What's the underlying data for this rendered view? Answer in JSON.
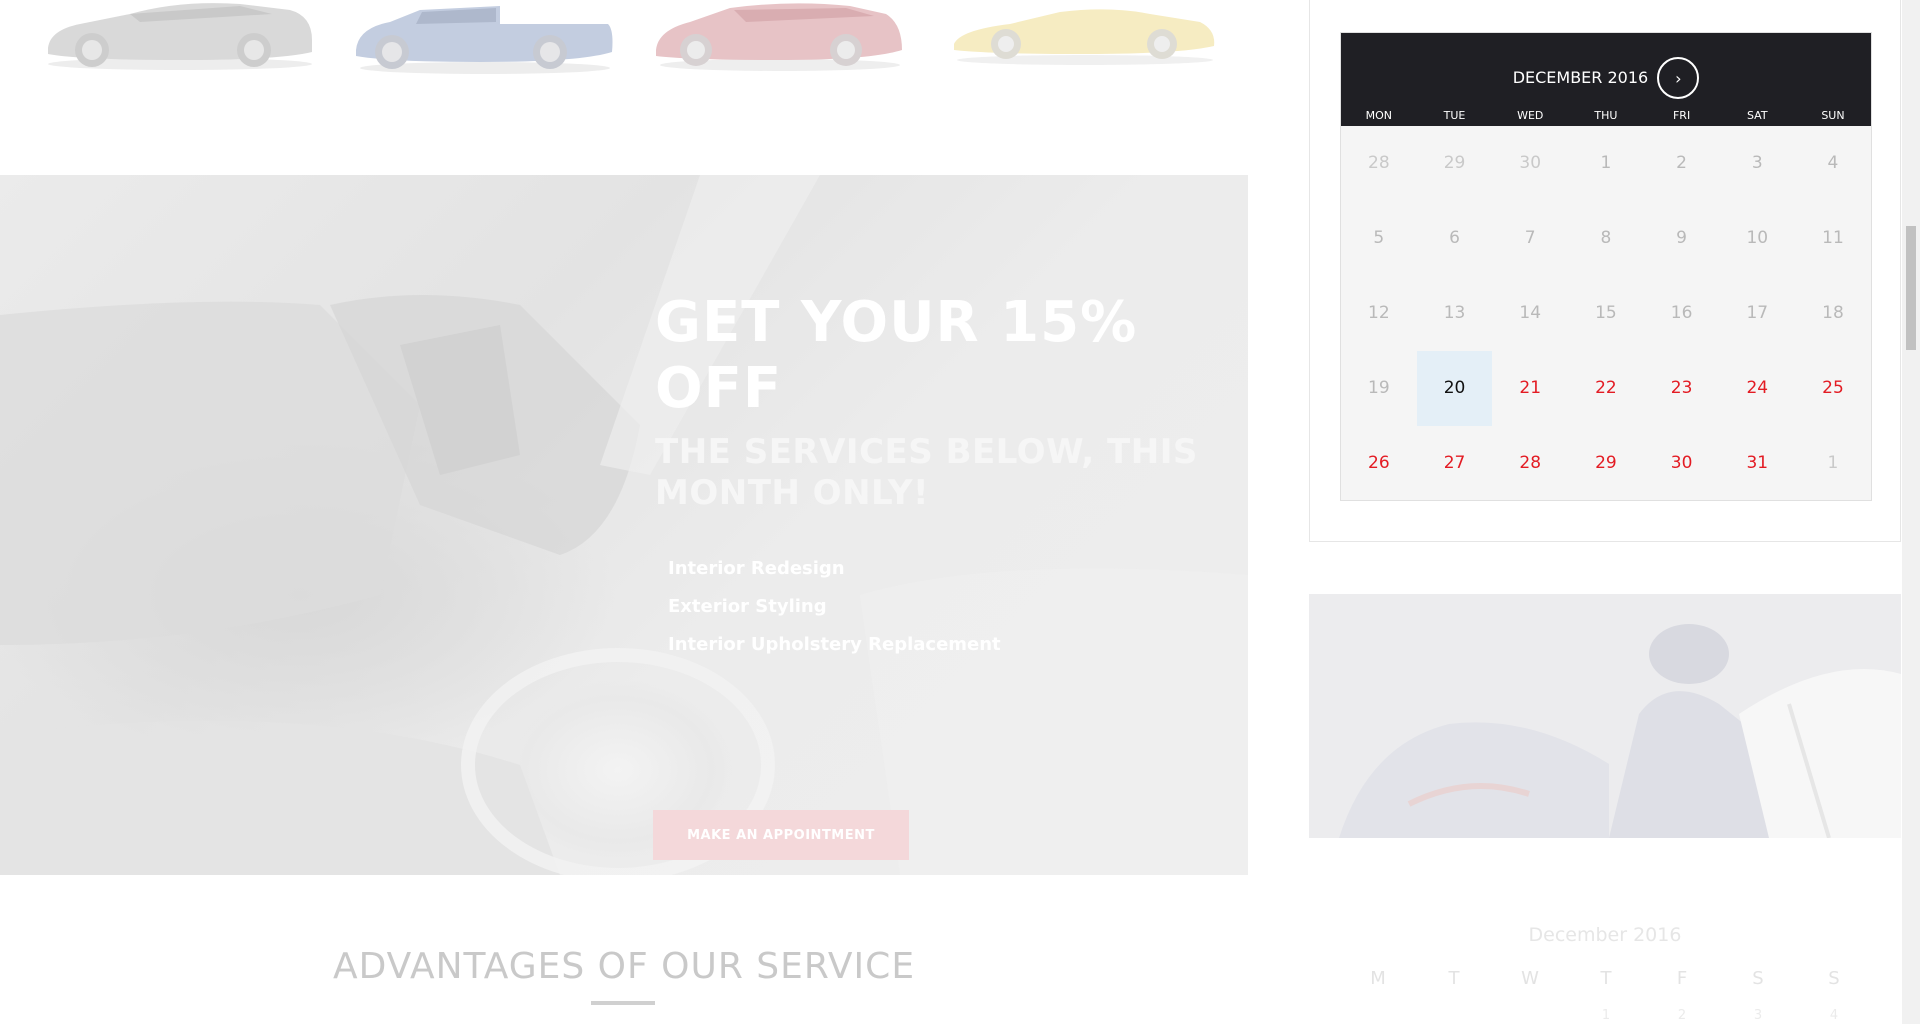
{
  "promo": {
    "title_line1": "GET YOUR 15%",
    "title_line2": "OFF",
    "subtitle_line1": "THE SERVICES BELOW, THIS",
    "subtitle_line2": "MONTH ONLY!",
    "services": [
      "Interior Redesign",
      "Exterior Styling",
      "Interior Upholstery Replacement"
    ],
    "button_label": "MAKE AN APPOINTMENT"
  },
  "advantages": {
    "title": "ADVANTAGES OF OUR SERVICE"
  },
  "calendar": {
    "month_label": "DECEMBER 2016",
    "next_icon": "chevron-right-icon",
    "next_glyph": "›",
    "weekdays": [
      "MON",
      "TUE",
      "WED",
      "THU",
      "FRI",
      "SAT",
      "SUN"
    ],
    "weeks": [
      [
        {
          "d": "28",
          "s": "muted"
        },
        {
          "d": "29",
          "s": "muted"
        },
        {
          "d": "30",
          "s": "muted"
        },
        {
          "d": "1",
          "s": "past"
        },
        {
          "d": "2",
          "s": "past"
        },
        {
          "d": "3",
          "s": "past"
        },
        {
          "d": "4",
          "s": "past"
        }
      ],
      [
        {
          "d": "5",
          "s": "past"
        },
        {
          "d": "6",
          "s": "past"
        },
        {
          "d": "7",
          "s": "past"
        },
        {
          "d": "8",
          "s": "past"
        },
        {
          "d": "9",
          "s": "past"
        },
        {
          "d": "10",
          "s": "past"
        },
        {
          "d": "11",
          "s": "past"
        }
      ],
      [
        {
          "d": "12",
          "s": "past"
        },
        {
          "d": "13",
          "s": "past"
        },
        {
          "d": "14",
          "s": "past"
        },
        {
          "d": "15",
          "s": "past"
        },
        {
          "d": "16",
          "s": "past"
        },
        {
          "d": "17",
          "s": "past"
        },
        {
          "d": "18",
          "s": "past"
        }
      ],
      [
        {
          "d": "19",
          "s": "past"
        },
        {
          "d": "20",
          "s": "today"
        },
        {
          "d": "21",
          "s": "avail"
        },
        {
          "d": "22",
          "s": "avail"
        },
        {
          "d": "23",
          "s": "avail"
        },
        {
          "d": "24",
          "s": "avail"
        },
        {
          "d": "25",
          "s": "avail"
        }
      ],
      [
        {
          "d": "26",
          "s": "avail"
        },
        {
          "d": "27",
          "s": "avail"
        },
        {
          "d": "28",
          "s": "avail"
        },
        {
          "d": "29",
          "s": "avail"
        },
        {
          "d": "30",
          "s": "avail"
        },
        {
          "d": "31",
          "s": "avail"
        },
        {
          "d": "1",
          "s": "muted"
        }
      ]
    ],
    "colors": {
      "header": "#1f1f24",
      "available": "#e31b23",
      "today_bg": "#e4eff7"
    }
  },
  "mini_calendar": {
    "title": "December 2016",
    "weekdays": [
      "M",
      "T",
      "W",
      "T",
      "F",
      "S",
      "S"
    ],
    "first_row": [
      "",
      "",
      "",
      "1",
      "2",
      "3",
      "4"
    ]
  }
}
